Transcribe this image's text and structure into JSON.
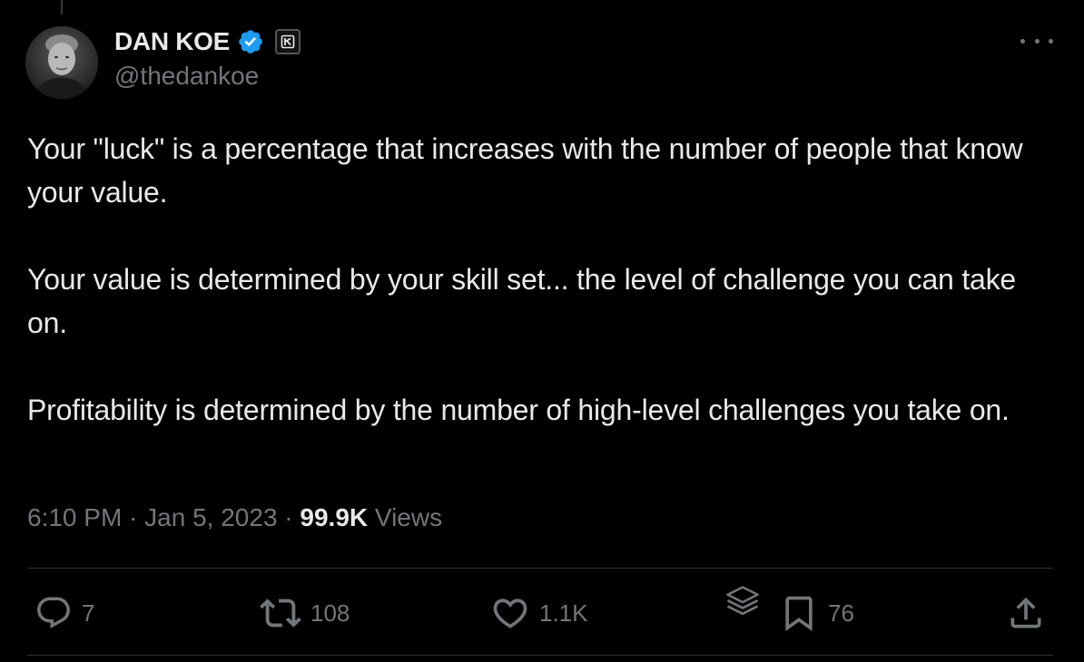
{
  "author": {
    "display_name": "DAN KOE",
    "handle": "@thedankoe"
  },
  "colors": {
    "background": "#000000",
    "text_primary": "#e7e9ea",
    "text_secondary": "#71767b",
    "verified_blue": "#1d9bf0",
    "divider": "#2f3336"
  },
  "tweet": {
    "paragraphs": [
      "Your \"luck\" is a percentage that increases with the number of people that know your value.",
      "Your value is determined by your skill set... the level of challenge you can take on.",
      "Profitability is determined by the number of high-level challenges you take on."
    ]
  },
  "meta": {
    "time": "6:10 PM",
    "separator1": " · ",
    "date": "Jan 5, 2023",
    "separator2": " · ",
    "views_count": "99.9K",
    "views_label": " Views"
  },
  "actions": {
    "replies": "7",
    "reposts": "108",
    "likes": "1.1K",
    "bookmarks": "76"
  },
  "icons": {
    "verified": "verified-badge-icon",
    "affiliate": "affiliate-badge-icon",
    "more": "more-icon",
    "reply": "reply-icon",
    "repost": "repost-icon",
    "like": "heart-icon",
    "grok": "grok-icon",
    "bookmark": "bookmark-icon",
    "share": "share-icon"
  }
}
